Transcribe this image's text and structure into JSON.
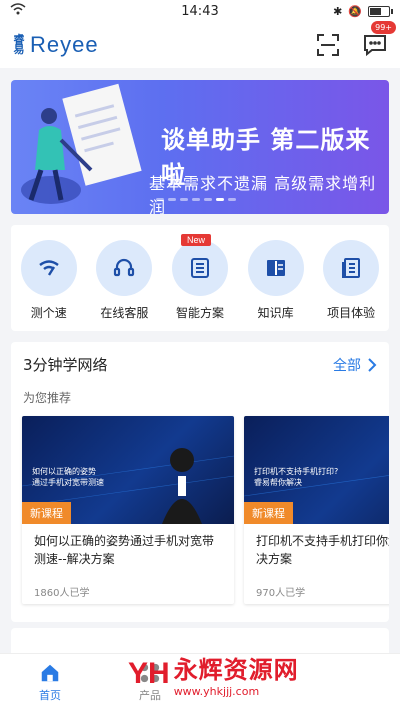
{
  "status_bar": {
    "time": "14:43"
  },
  "header": {
    "logo_mark": "睿易",
    "logo_text": "Reyee",
    "notification_count": "99+"
  },
  "banner": {
    "title": "谈单助手 第二版来啦",
    "subtitle": "基本需求不遗漏   高级需求增利润"
  },
  "quick_actions": [
    {
      "label": "测个速",
      "icon": "wifi-speed-icon"
    },
    {
      "label": "在线客服",
      "icon": "headset-icon"
    },
    {
      "label": "智能方案",
      "icon": "list-doc-icon",
      "tag": "New"
    },
    {
      "label": "知识库",
      "icon": "book-icon"
    },
    {
      "label": "项目体验",
      "icon": "document-icon"
    }
  ],
  "learn": {
    "title": "3分钟学网络",
    "more_label": "全部",
    "recommend_label": "为您推荐",
    "courses": [
      {
        "tag": "新课程",
        "title": "如何以正确的姿势通过手机对宽带测速--解决方案",
        "meta": "1860人已学",
        "thumb_text": "如何以正确的姿势\n通过手机对宽带测速"
      },
      {
        "tag": "新课程",
        "title": "打印机不支持手机打印你解决--解决方案",
        "meta": "970人已学",
        "thumb_text": "打印机不支持手机打印?\n睿易帮你解决"
      }
    ]
  },
  "tabbar": {
    "items": [
      {
        "label": "首页"
      },
      {
        "label": "产品"
      }
    ]
  },
  "watermark": {
    "cn": "永辉资源网",
    "url": "www.yhkjjj.com"
  },
  "colors": {
    "accent": "#2a7be4",
    "badge": "#e53935",
    "course_tag": "#f08a2a"
  }
}
